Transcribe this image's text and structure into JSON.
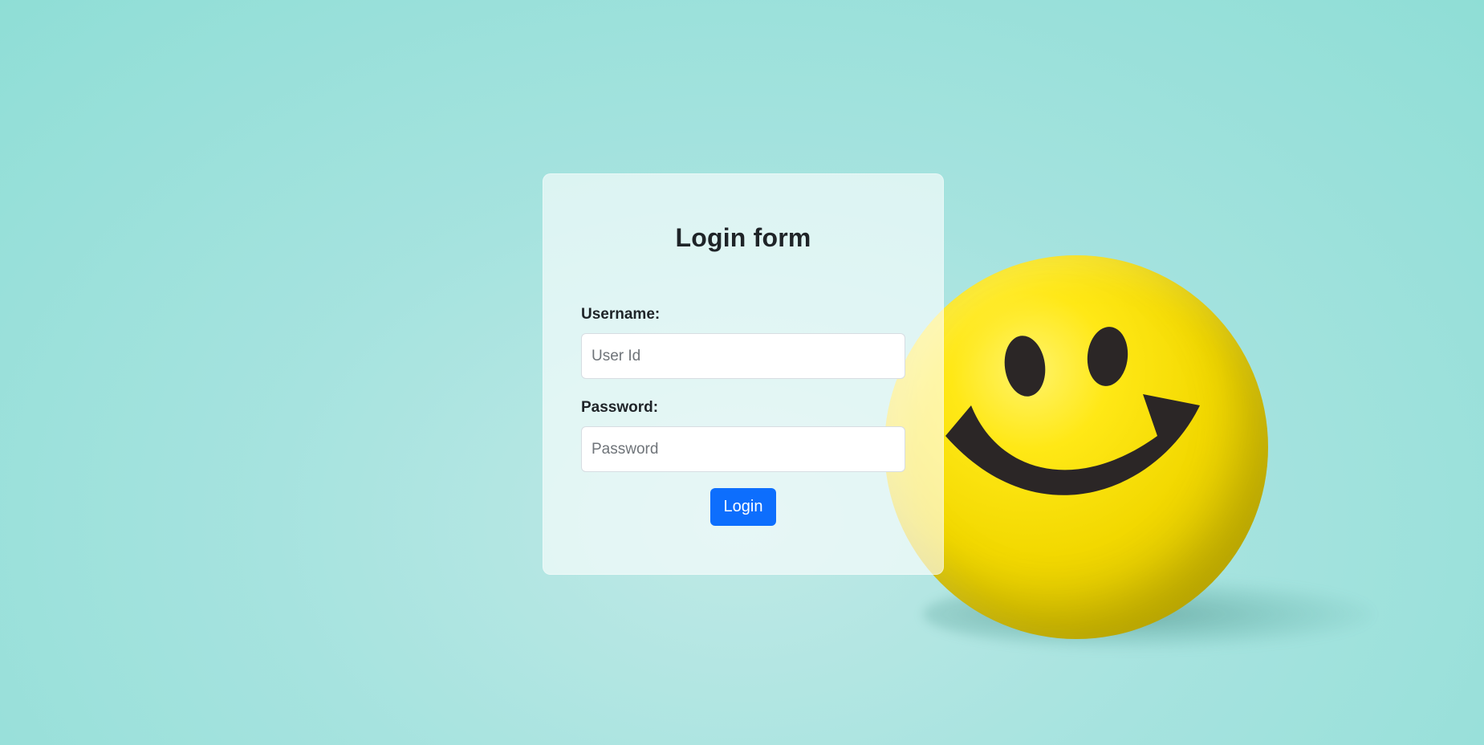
{
  "form": {
    "title": "Login form",
    "username": {
      "label": "Username:",
      "placeholder": "User Id",
      "value": ""
    },
    "password": {
      "label": "Password:",
      "placeholder": "Password",
      "value": ""
    },
    "submit_label": "Login"
  },
  "background": {
    "image_subject": "yellow-smiley-stress-ball",
    "colors": {
      "teal_background": "#a6e3df",
      "ball_yellow": "#ffe816",
      "face_features": "#2b2b2b",
      "button_blue": "#0d6efd"
    }
  }
}
